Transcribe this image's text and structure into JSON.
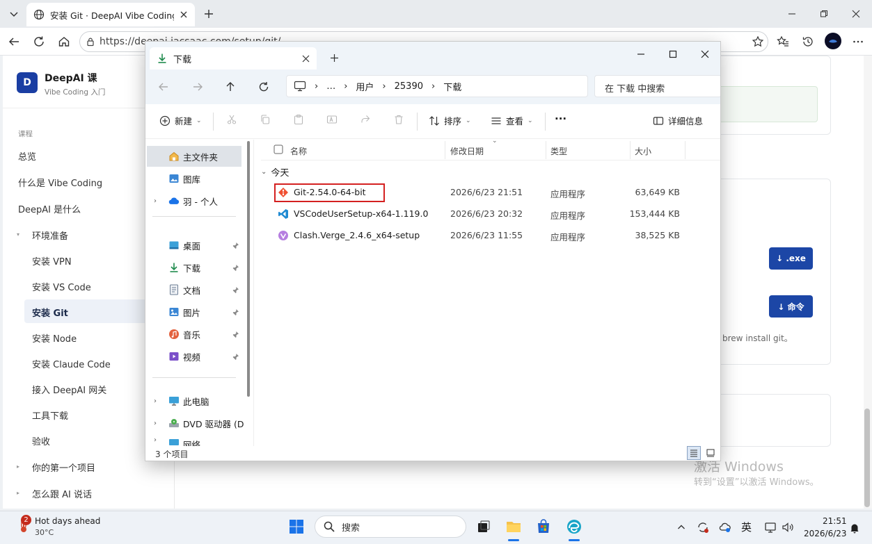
{
  "browser": {
    "tab_title": "安装 Git · DeepAI Vibe Coding 课",
    "url": "https://deepai.jacsaac.com/setup/git/"
  },
  "site": {
    "logo_letter": "D",
    "title": "DeepAI 课",
    "subtitle": "Vibe Coding 入门",
    "section_label": "课程",
    "nav": [
      {
        "label": "总览"
      },
      {
        "label": "什么是 Vibe Coding"
      },
      {
        "label": "DeepAI 是什么"
      },
      {
        "label": "环境准备"
      },
      {
        "label": "安装 VPN"
      },
      {
        "label": "安装 VS Code"
      },
      {
        "label": "安装 Git"
      },
      {
        "label": "安装 Node"
      },
      {
        "label": "安装 Claude Code"
      },
      {
        "label": "接入 DeepAI 网关"
      },
      {
        "label": "工具下载"
      },
      {
        "label": "验收"
      },
      {
        "label": "你的第一个项目"
      },
      {
        "label": "怎么跟 AI 说话"
      }
    ],
    "download_exe": "↓ .exe",
    "download_cmd": "↓ 命令",
    "brew_text": "brew install git。",
    "watermark_title": "激活 Windows",
    "watermark_sub": "转到“设置”以激活 Windows。"
  },
  "explorer": {
    "tab_title": "下载",
    "breadcrumb": [
      "…",
      "用户",
      "25390",
      "下载"
    ],
    "search_placeholder": "在 下载 中搜索",
    "toolbar": {
      "new": "新建",
      "sort": "排序",
      "view": "查看",
      "more": "···",
      "details": "详细信息"
    },
    "nav_pane": {
      "home": "主文件夹",
      "gallery": "图库",
      "onedrive": "羽 - 个人",
      "desktop": "桌面",
      "downloads": "下载",
      "documents": "文档",
      "pictures": "图片",
      "music": "音乐",
      "videos": "视频",
      "thispc": "此电脑",
      "dvd": "DVD 驱动器 (D",
      "network": "网络"
    },
    "columns": {
      "name": "名称",
      "date": "修改日期",
      "type": "类型",
      "size": "大小"
    },
    "group": "今天",
    "files": [
      {
        "name": "Git-2.54.0-64-bit",
        "date": "2026/6/23 21:51",
        "type": "应用程序",
        "size": "63,649 KB"
      },
      {
        "name": "VSCodeUserSetup-x64-1.119.0",
        "date": "2026/6/23 20:32",
        "type": "应用程序",
        "size": "153,444 KB"
      },
      {
        "name": "Clash.Verge_2.4.6_x64-setup",
        "date": "2026/6/23 11:55",
        "type": "应用程序",
        "size": "38,525 KB"
      }
    ],
    "status": "3 个项目"
  },
  "taskbar": {
    "weather_badge": "2",
    "weather_text": "Hot days ahead",
    "weather_temp": "30°C",
    "search": "搜索",
    "ime": "英",
    "time": "21:51",
    "date": "2026/6/23"
  }
}
